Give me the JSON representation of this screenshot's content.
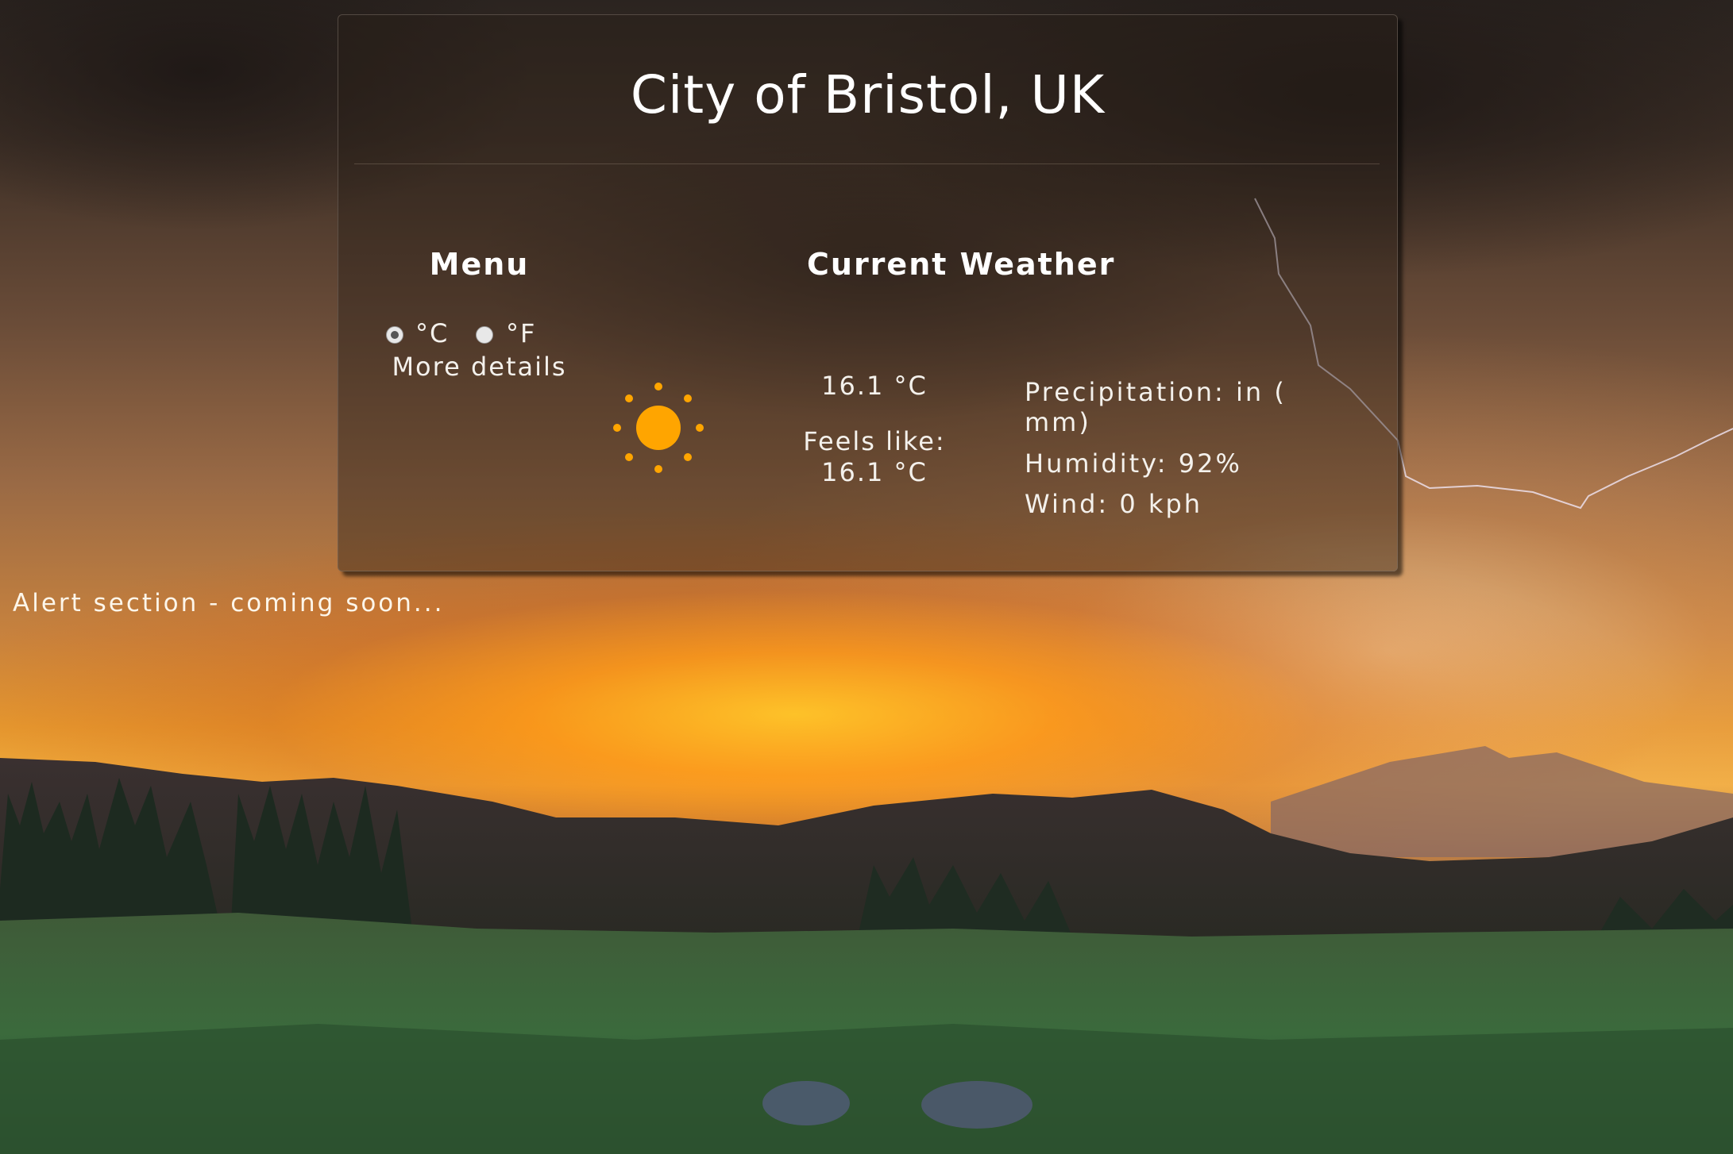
{
  "card": {
    "title": "City of Bristol, UK"
  },
  "menu": {
    "heading": "Menu",
    "units": [
      {
        "label": "°C",
        "selected": true
      },
      {
        "label": "°F",
        "selected": false
      }
    ],
    "more_details": "More details"
  },
  "current_weather": {
    "heading": "Current Weather",
    "icon": "sun-icon",
    "icon_color": "#ffa500",
    "temperature": "16.1 °C",
    "feels_like": "Feels like: 16.1 °C",
    "precipitation": "Precipitation: in ( mm)",
    "humidity": "Humidity: 92%",
    "wind": "Wind: 0 kph"
  },
  "alert": {
    "text": "Alert section - coming soon..."
  }
}
